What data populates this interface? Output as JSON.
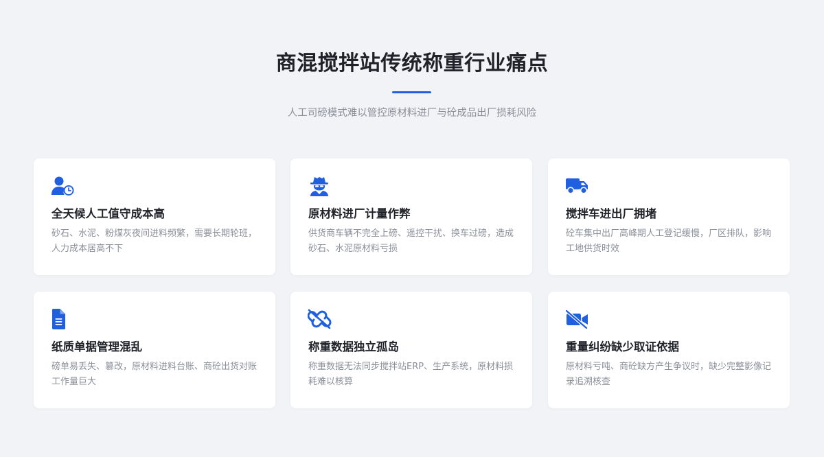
{
  "header": {
    "title": "商混搅拌站传统称重行业痛点",
    "subtitle": "人工司磅模式难以管控原材料进厂与砼成品出厂损耗风险"
  },
  "theme": {
    "accent": "#1f5fe0",
    "background": "#f1f3f6",
    "card": "#ffffff",
    "muted_text": "#8a8f99"
  },
  "cards": [
    {
      "icon": "user-clock-icon",
      "title": "全天候人工值守成本高",
      "desc": "砂石、水泥、粉煤灰夜间进料频繁，需要长期轮班，人力成本居高不下"
    },
    {
      "icon": "user-secret-icon",
      "title": "原材料进厂计量作弊",
      "desc": "供货商车辆不完全上磅、遥控干扰、换车过磅，造成砂石、水泥原材料亏损"
    },
    {
      "icon": "truck-icon",
      "title": "搅拌车进出厂拥堵",
      "desc": "砼车集中出厂高峰期人工登记缓慢，厂区排队，影响工地供货时效"
    },
    {
      "icon": "file-icon",
      "title": "纸质单据管理混乱",
      "desc": "磅单易丢失、篡改，原材料进料台账、商砼出货对账工作量巨大"
    },
    {
      "icon": "unlink-icon",
      "title": "称重数据独立孤岛",
      "desc": "称重数据无法同步搅拌站ERP、生产系统，原材料损耗难以核算"
    },
    {
      "icon": "video-slash-icon",
      "title": "重量纠纷缺少取证依据",
      "desc": "原材料亏吨、商砼缺方产生争议时，缺少完整影像记录追溯核查"
    }
  ]
}
